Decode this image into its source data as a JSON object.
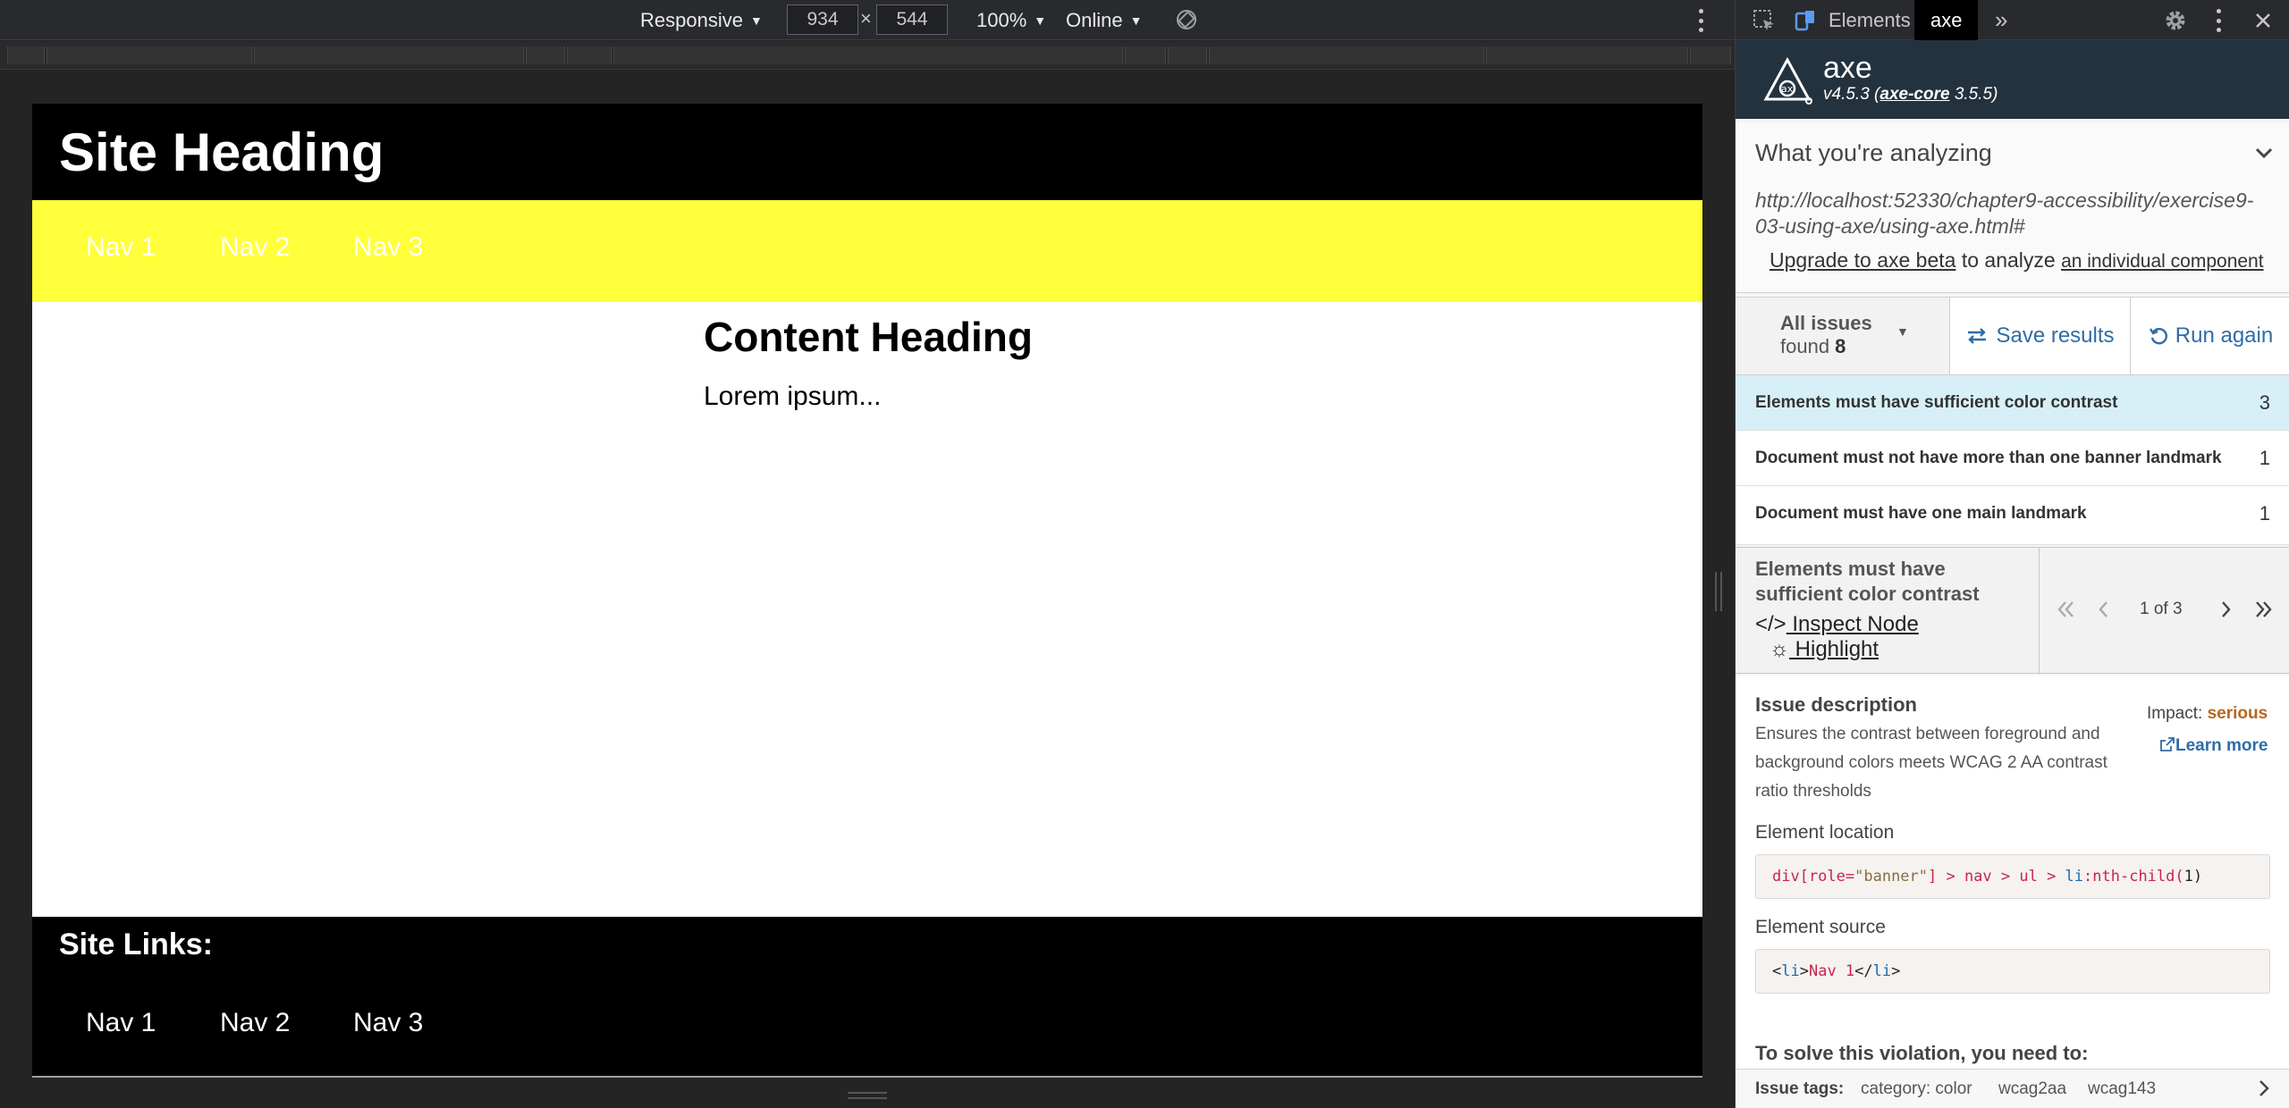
{
  "device_toolbar": {
    "device": "Responsive",
    "width": "934",
    "height": "544",
    "times": "×",
    "zoom": "100%",
    "network": "Online"
  },
  "site": {
    "heading": "Site Heading",
    "nav": [
      "Nav 1",
      "Nav 2",
      "Nav 3"
    ],
    "content_heading": "Content Heading",
    "content_body": "Lorem ipsum...",
    "footer_title": "Site Links:",
    "footer_nav": [
      "Nav 1",
      "Nav 2",
      "Nav 3"
    ],
    "colors": {
      "header_bg": "#000000",
      "nav_bg": "#ffff3b",
      "nav_text": "#ffffff"
    }
  },
  "devtools": {
    "tabs": {
      "elements": "Elements",
      "axe": "axe",
      "more": "»"
    },
    "icons": [
      "inspect-element-icon",
      "device-toolbar-icon",
      "gear-icon",
      "kebab-menu-icon",
      "close-icon"
    ]
  },
  "axe": {
    "name": "axe",
    "version_prefix": "v4.5.3 (",
    "core": "axe-core",
    "core_version": " 3.5.5)",
    "analyzing_title": "What you're analyzing",
    "url": "http://localhost:52330/chapter9-accessibility/exercise9-03-using-axe/using-axe.html#",
    "upgrade_link": "Upgrade to axe beta",
    "upgrade_mid": " to analyze ",
    "upgrade_link2": "an individual component",
    "filter_label": "All issues",
    "found_prefix": "found ",
    "found_count": "8",
    "save_label": "Save results",
    "run_label": "Run again",
    "issues": [
      {
        "text": "Elements must have sufficient color contrast",
        "count": "3"
      },
      {
        "text": "Document must not have more than one banner landmark",
        "count": "1"
      },
      {
        "text": "Document must have one main landmark",
        "count": "1"
      }
    ],
    "detail": {
      "title": "Elements must have sufficient color contrast",
      "inspect_label": " Inspect Node",
      "highlight_label": " Highlight",
      "pager": "1 of 3",
      "desc_title": "Issue description",
      "desc_text": "Ensures the contrast between foreground and background colors meets WCAG 2 AA contrast ratio thresholds",
      "impact_label": "Impact: ",
      "impact_value": "serious",
      "learn_more": "Learn more",
      "location_label": "Element location",
      "location_code": {
        "p1": "div[role=",
        "p2": "\"banner\"",
        "p3": "] > nav > ul > ",
        "p4": "li",
        "p5": ":nth-child(",
        "p6": "1",
        "p7": ")"
      },
      "source_label": "Element source",
      "source_code": {
        "p1": "<",
        "p2": "li",
        "p3": ">",
        "p4": "Nav 1",
        "p5": "</",
        "p6": "li",
        "p7": ">"
      },
      "cut_text": "To solve this violation, you need to:"
    },
    "tags_label": "Issue tags:",
    "tags": [
      "category: color",
      "wcag2aa",
      "wcag143"
    ]
  }
}
